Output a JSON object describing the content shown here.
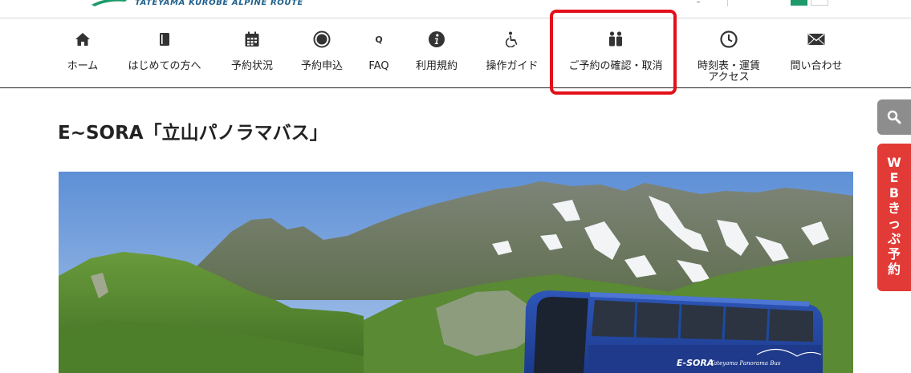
{
  "header": {
    "logo_text": "TATEYAMA KUROBE ALPINE ROUTE"
  },
  "nav": {
    "items": [
      {
        "label": "ホーム",
        "icon": "home-icon"
      },
      {
        "label": "はじめての方へ",
        "icon": "book-icon"
      },
      {
        "label": "予約状況",
        "icon": "calendar-icon"
      },
      {
        "label": "予約申込",
        "icon": "record-circle-icon"
      },
      {
        "label": "FAQ",
        "icon": "q-icon"
      },
      {
        "label": "利用規約",
        "icon": "info-icon"
      },
      {
        "label": "操作ガイド",
        "icon": "wheelchair-icon"
      },
      {
        "label": "ご予約の確認・取消",
        "icon": "people-icon"
      },
      {
        "label": "時刻表・運賃アクセス",
        "icon": "clock-icon"
      },
      {
        "label": "問い合わせ",
        "icon": "envelope-icon"
      }
    ],
    "faq_icon_letter": "Q",
    "highlighted_item": "ご予約の確認・取消",
    "highlight_color": "#e3101a"
  },
  "page": {
    "title": "E~SORA「立山パノラマバス」"
  },
  "hero": {
    "bus_brand": "E-SORA",
    "bus_subtitle": "Tateyama Panorama Bus"
  },
  "side_widgets": {
    "search_icon": "search-icon",
    "web_ticket_label": [
      "W",
      "E",
      "B",
      "き",
      "っ",
      "ぷ",
      "予",
      "約"
    ],
    "web_ticket_color": "#e23a36"
  },
  "colors": {
    "brand_green": "#1e9a6a",
    "brand_blue": "#1f5f8c",
    "search_tab": "#8d8d8d"
  }
}
